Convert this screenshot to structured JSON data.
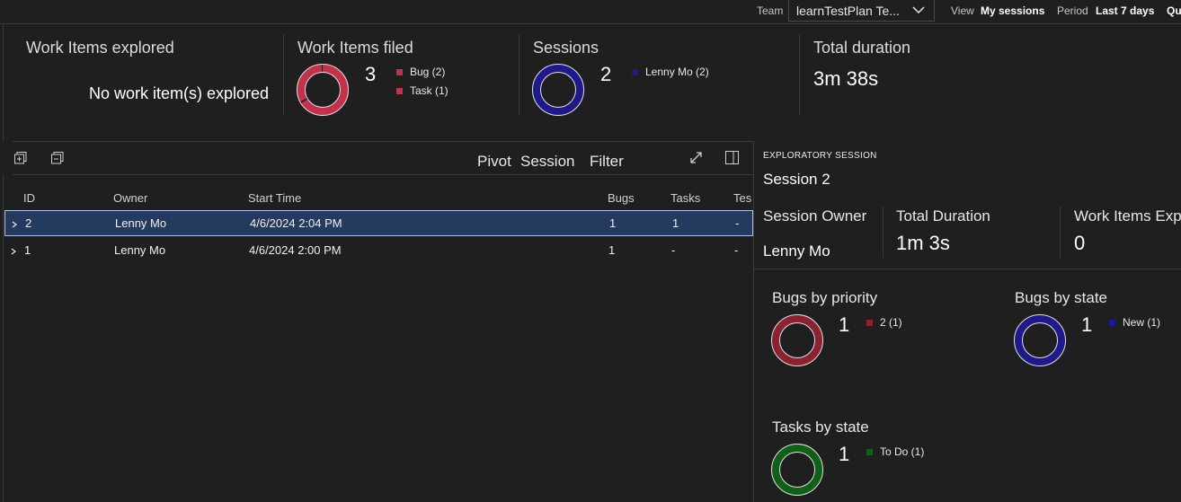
{
  "filter_bar": {
    "team_label": "Team",
    "team_value": "learnTestPlan Te...",
    "view_label": "View",
    "view_value": "My sessions",
    "period_label": "Period",
    "period_value": "Last 7 days",
    "query_label": "Qu"
  },
  "summary": {
    "work_items_explored": {
      "title": "Work Items explored",
      "empty_text": "No work item(s) explored"
    },
    "work_items_filed": {
      "title": "Work Items filed",
      "total": "3",
      "legend": [
        {
          "label": "Bug (2)",
          "color": "#c4314b",
          "value": 2
        },
        {
          "label": "Task (1)",
          "color": "#c4314b",
          "value": 1
        }
      ]
    },
    "sessions": {
      "title": "Sessions",
      "total": "2",
      "legend": [
        {
          "label": "Lenny Mo (2)",
          "color": "#1e1a8c",
          "value": 2
        }
      ]
    },
    "total_duration": {
      "title": "Total duration",
      "value": "3m 38s"
    }
  },
  "grid_toolbar": {
    "pivot_label": "Pivot",
    "pivot_value": "Session",
    "filter_label": "Filter"
  },
  "grid": {
    "columns": [
      "ID",
      "Owner",
      "Start Time",
      "Bugs",
      "Tasks",
      "Tes"
    ],
    "rows": [
      {
        "id": "2",
        "owner": "Lenny Mo",
        "start_time": "4/6/2024 2:04 PM",
        "bugs": "1",
        "tasks": "1",
        "tests": "-"
      },
      {
        "id": "1",
        "owner": "Lenny Mo",
        "start_time": "4/6/2024 2:00 PM",
        "bugs": "1",
        "tasks": "-",
        "tests": "-"
      }
    ]
  },
  "detail": {
    "header": "EXPLORATORY SESSION",
    "session_name": "Session 2",
    "owner_label": "Session Owner",
    "owner_value": "Lenny Mo",
    "duration_label": "Total Duration",
    "duration_value": "1m 3s",
    "explored_label": "Work Items Exp",
    "explored_value": "0",
    "bugs_by_priority": {
      "title": "Bugs by priority",
      "total": "1",
      "legend": [
        {
          "label": "2 (1)",
          "color": "#8b2232"
        }
      ]
    },
    "bugs_by_state": {
      "title": "Bugs by state",
      "total": "1",
      "legend": [
        {
          "label": "New (1)",
          "color": "#1e1a8c"
        }
      ]
    },
    "tasks_by_state": {
      "title": "Tasks by state",
      "total": "1",
      "legend": [
        {
          "label": "To Do (1)",
          "color": "#10601a"
        }
      ]
    }
  }
}
